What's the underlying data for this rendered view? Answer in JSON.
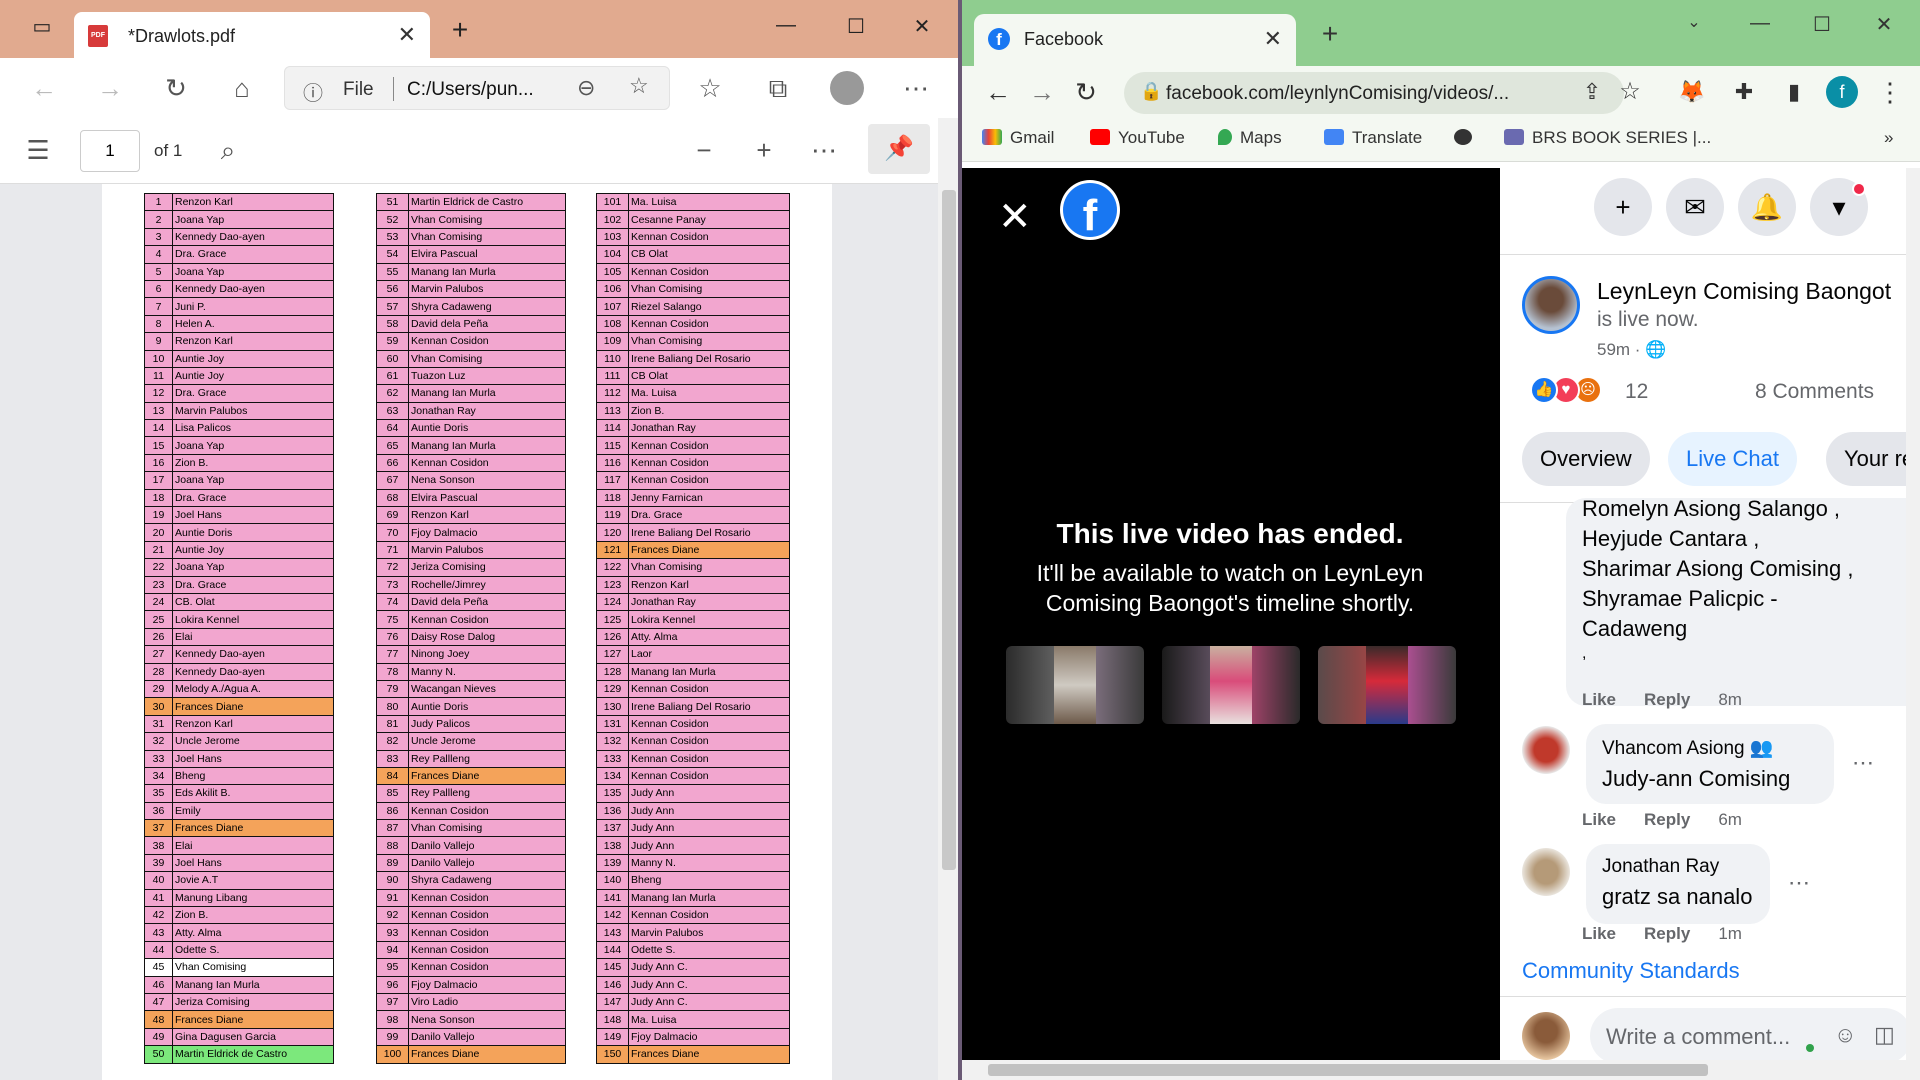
{
  "left": {
    "tab_title": "*Drawlots.pdf",
    "address_scheme": "File",
    "address_path": "C:/Users/pun...",
    "page_current": "1",
    "page_of": "of 1",
    "list": [
      [
        "1",
        "Renzon Karl",
        "pk"
      ],
      [
        "2",
        "Joana Yap",
        "pk"
      ],
      [
        "3",
        "Kennedy Dao-ayen",
        "pk"
      ],
      [
        "4",
        "Dra. Grace",
        "pk"
      ],
      [
        "5",
        "Joana Yap",
        "pk"
      ],
      [
        "6",
        "Kennedy Dao-ayen",
        "pk"
      ],
      [
        "7",
        "Juni P.",
        "pk"
      ],
      [
        "8",
        "Helen A.",
        "pk"
      ],
      [
        "9",
        "Renzon Karl",
        "pk"
      ],
      [
        "10",
        "Auntie Joy",
        "pk"
      ],
      [
        "11",
        "Auntie Joy",
        "pk"
      ],
      [
        "12",
        "Dra. Grace",
        "pk"
      ],
      [
        "13",
        "Marvin Palubos",
        "pk"
      ],
      [
        "14",
        "Lisa Palicos",
        "pk"
      ],
      [
        "15",
        "Joana Yap",
        "pk"
      ],
      [
        "16",
        "Zion B.",
        "pk"
      ],
      [
        "17",
        "Joana Yap",
        "pk"
      ],
      [
        "18",
        "Dra. Grace",
        "pk"
      ],
      [
        "19",
        "Joel Hans",
        "pk"
      ],
      [
        "20",
        "Auntie Doris",
        "pk"
      ],
      [
        "21",
        "Auntie Joy",
        "pk"
      ],
      [
        "22",
        "Joana Yap",
        "pk"
      ],
      [
        "23",
        "Dra. Grace",
        "pk"
      ],
      [
        "24",
        "CB. Olat",
        "pk"
      ],
      [
        "25",
        "Lokira Kennel",
        "pk"
      ],
      [
        "26",
        "Elai",
        "pk"
      ],
      [
        "27",
        "Kennedy Dao-ayen",
        "pk"
      ],
      [
        "28",
        "Kennedy Dao-ayen",
        "pk"
      ],
      [
        "29",
        "Melody A./Agua A.",
        "pk"
      ],
      [
        "30",
        "Frances Diane",
        "or"
      ],
      [
        "31",
        "Renzon Karl",
        "pk"
      ],
      [
        "32",
        "Uncle Jerome",
        "pk"
      ],
      [
        "33",
        "Joel Hans",
        "pk"
      ],
      [
        "34",
        "Bheng",
        "pk"
      ],
      [
        "35",
        "Eds Akilit B.",
        "pk"
      ],
      [
        "36",
        "Emily",
        "pk"
      ],
      [
        "37",
        "Frances Diane",
        "or"
      ],
      [
        "38",
        "Elai",
        "pk"
      ],
      [
        "39",
        "Joel Hans",
        "pk"
      ],
      [
        "40",
        "Jovie A.T",
        "pk"
      ],
      [
        "41",
        "Manung Libang",
        "pk"
      ],
      [
        "42",
        "Zion B.",
        "pk"
      ],
      [
        "43",
        "Atty. Alma",
        "pk"
      ],
      [
        "44",
        "Odette S.",
        "pk"
      ],
      [
        "45",
        "Vhan Comising",
        "wh"
      ],
      [
        "46",
        "Manang Ian Murla",
        "pk"
      ],
      [
        "47",
        "Jeriza Comising",
        "pk"
      ],
      [
        "48",
        "Frances Diane",
        "or"
      ],
      [
        "49",
        "Gina Dagusen Garcia",
        "pk"
      ],
      [
        "50",
        "Martin Eldrick de Castro",
        "gr"
      ],
      [
        "51",
        "Martin Eldrick de Castro",
        "pk"
      ],
      [
        "52",
        "Vhan Comising",
        "pk"
      ],
      [
        "53",
        "Vhan Comising",
        "pk"
      ],
      [
        "54",
        "Elvira Pascual",
        "pk"
      ],
      [
        "55",
        "Manang Ian Murla",
        "pk"
      ],
      [
        "56",
        "Marvin Palubos",
        "pk"
      ],
      [
        "57",
        "Shyra Cadaweng",
        "pk"
      ],
      [
        "58",
        "David dela Peña",
        "pk"
      ],
      [
        "59",
        "Kennan Cosidon",
        "pk"
      ],
      [
        "60",
        "Vhan Comising",
        "pk"
      ],
      [
        "61",
        "Tuazon Luz",
        "pk"
      ],
      [
        "62",
        "Manang Ian Murla",
        "pk"
      ],
      [
        "63",
        "Jonathan Ray",
        "pk"
      ],
      [
        "64",
        "Auntie Doris",
        "pk"
      ],
      [
        "65",
        "Manang Ian Murla",
        "pk"
      ],
      [
        "66",
        "Kennan Cosidon",
        "pk"
      ],
      [
        "67",
        "Nena Sonson",
        "pk"
      ],
      [
        "68",
        "Elvira Pascual",
        "pk"
      ],
      [
        "69",
        "Renzon Karl",
        "pk"
      ],
      [
        "70",
        "Fjoy Dalmacio",
        "pk"
      ],
      [
        "71",
        "Marvin Palubos",
        "pk"
      ],
      [
        "72",
        "Jeriza Comising",
        "pk"
      ],
      [
        "73",
        "Rochelle/Jimrey",
        "pk"
      ],
      [
        "74",
        "David dela Peña",
        "pk"
      ],
      [
        "75",
        "Kennan Cosidon",
        "pk"
      ],
      [
        "76",
        "Daisy Rose Dalog",
        "pk"
      ],
      [
        "77",
        "Ninong Joey",
        "pk"
      ],
      [
        "78",
        "Manny N.",
        "pk"
      ],
      [
        "79",
        "Wacangan Nieves",
        "pk"
      ],
      [
        "80",
        "Auntie Doris",
        "pk"
      ],
      [
        "81",
        "Judy Palicos",
        "pk"
      ],
      [
        "82",
        "Uncle Jerome",
        "pk"
      ],
      [
        "83",
        "Rey Pallleng",
        "pk"
      ],
      [
        "84",
        "Frances Diane",
        "or"
      ],
      [
        "85",
        "Rey Pallleng",
        "pk"
      ],
      [
        "86",
        "Kennan Cosidon",
        "pk"
      ],
      [
        "87",
        "Vhan Comising",
        "pk"
      ],
      [
        "88",
        "Danilo Vallejo",
        "pk"
      ],
      [
        "89",
        "Danilo Vallejo",
        "pk"
      ],
      [
        "90",
        "Shyra Cadaweng",
        "pk"
      ],
      [
        "91",
        "Kennan Cosidon",
        "pk"
      ],
      [
        "92",
        "Kennan Cosidon",
        "pk"
      ],
      [
        "93",
        "Kennan Cosidon",
        "pk"
      ],
      [
        "94",
        "Kennan Cosidon",
        "pk"
      ],
      [
        "95",
        "Kennan Cosidon",
        "pk"
      ],
      [
        "96",
        "Fjoy Dalmacio",
        "pk"
      ],
      [
        "97",
        "Viro Ladio",
        "pk"
      ],
      [
        "98",
        "Nena Sonson",
        "pk"
      ],
      [
        "99",
        "Danilo Vallejo",
        "pk"
      ],
      [
        "100",
        "Frances Diane",
        "or"
      ],
      [
        "101",
        "Ma. Luisa",
        "pk"
      ],
      [
        "102",
        "Cesanne Panay",
        "pk"
      ],
      [
        "103",
        "Kennan Cosidon",
        "pk"
      ],
      [
        "104",
        "CB Olat",
        "pk"
      ],
      [
        "105",
        "Kennan Cosidon",
        "pk"
      ],
      [
        "106",
        "Vhan Comising",
        "pk"
      ],
      [
        "107",
        "Riezel Salango",
        "pk"
      ],
      [
        "108",
        "Kennan Cosidon",
        "pk"
      ],
      [
        "109",
        "Vhan Comising",
        "pk"
      ],
      [
        "110",
        "Irene Baliang Del Rosario",
        "pk"
      ],
      [
        "111",
        "CB Olat",
        "pk"
      ],
      [
        "112",
        "Ma. Luisa",
        "pk"
      ],
      [
        "113",
        "Zion B.",
        "pk"
      ],
      [
        "114",
        "Jonathan Ray",
        "pk"
      ],
      [
        "115",
        "Kennan Cosidon",
        "pk"
      ],
      [
        "116",
        "Kennan Cosidon",
        "pk"
      ],
      [
        "117",
        "Kennan Cosidon",
        "pk"
      ],
      [
        "118",
        "Jenny Farnican",
        "pk"
      ],
      [
        "119",
        "Dra. Grace",
        "pk"
      ],
      [
        "120",
        "Irene Baliang Del Rosario",
        "pk"
      ],
      [
        "121",
        "Frances Diane",
        "or"
      ],
      [
        "122",
        "Vhan Comising",
        "pk"
      ],
      [
        "123",
        "Renzon Karl",
        "pk"
      ],
      [
        "124",
        "Jonathan Ray",
        "pk"
      ],
      [
        "125",
        "Lokira Kennel",
        "pk"
      ],
      [
        "126",
        "Atty. Alma",
        "pk"
      ],
      [
        "127",
        "Laor",
        "pk"
      ],
      [
        "128",
        "Manang Ian Murla",
        "pk"
      ],
      [
        "129",
        "Kennan Cosidon",
        "pk"
      ],
      [
        "130",
        "Irene Baliang Del Rosario",
        "pk"
      ],
      [
        "131",
        "Kennan Cosidon",
        "pk"
      ],
      [
        "132",
        "Kennan Cosidon",
        "pk"
      ],
      [
        "133",
        "Kennan Cosidon",
        "pk"
      ],
      [
        "134",
        "Kennan Cosidon",
        "pk"
      ],
      [
        "135",
        "Judy Ann",
        "pk"
      ],
      [
        "136",
        "Judy Ann",
        "pk"
      ],
      [
        "137",
        "Judy Ann",
        "pk"
      ],
      [
        "138",
        "Judy Ann",
        "pk"
      ],
      [
        "139",
        "Manny N.",
        "pk"
      ],
      [
        "140",
        "Bheng",
        "pk"
      ],
      [
        "141",
        "Manang Ian Murla",
        "pk"
      ],
      [
        "142",
        "Kennan Cosidon",
        "pk"
      ],
      [
        "143",
        "Marvin Palubos",
        "pk"
      ],
      [
        "144",
        "Odette S.",
        "pk"
      ],
      [
        "145",
        "Judy Ann C.",
        "pk"
      ],
      [
        "146",
        "Judy Ann C.",
        "pk"
      ],
      [
        "147",
        "Judy Ann C.",
        "pk"
      ],
      [
        "148",
        "Ma. Luisa",
        "pk"
      ],
      [
        "149",
        "Fjoy Dalmacio",
        "pk"
      ],
      [
        "150",
        "Frances Diane",
        "or"
      ]
    ]
  },
  "right": {
    "tab_title": "Facebook",
    "url": "facebook.com/leynlynComising/videos/...",
    "bookmarks": [
      "Gmail",
      "YouTube",
      "Maps",
      "Translate",
      "BRS BOOK SERIES |..."
    ],
    "bookmark_more": "»",
    "video": {
      "ended_title": "This live video has ended.",
      "ended_sub": "It'll be available to watch on LeynLeyn Comising Baongot's timeline shortly."
    },
    "post": {
      "author": "LeynLeyn Comising Baongot",
      "status": "is live now.",
      "time": "59m ·",
      "reactions": "12",
      "comments": "8 Comments"
    },
    "tabs": [
      "Overview",
      "Live Chat",
      "Your re"
    ],
    "comments": {
      "c1_lines": [
        "Romelyn Asiong Salango ,",
        "Heyjude Cantara ,",
        "Sharimar Asiong Comising ,",
        "Shyramae Palicpic -",
        "Cadaweng",
        ","
      ],
      "c1_time": "8m",
      "c2_name": "Vhancom Asiong",
      "c2_body": "Judy-ann Comising",
      "c2_time": "6m",
      "c3_name": "Jonathan Ray",
      "c3_body": "gratz sa nanalo",
      "c3_time": "1m",
      "like": "Like",
      "reply": "Reply"
    },
    "community_standards": "Community Standards",
    "write_placeholder": "Write a comment..."
  }
}
